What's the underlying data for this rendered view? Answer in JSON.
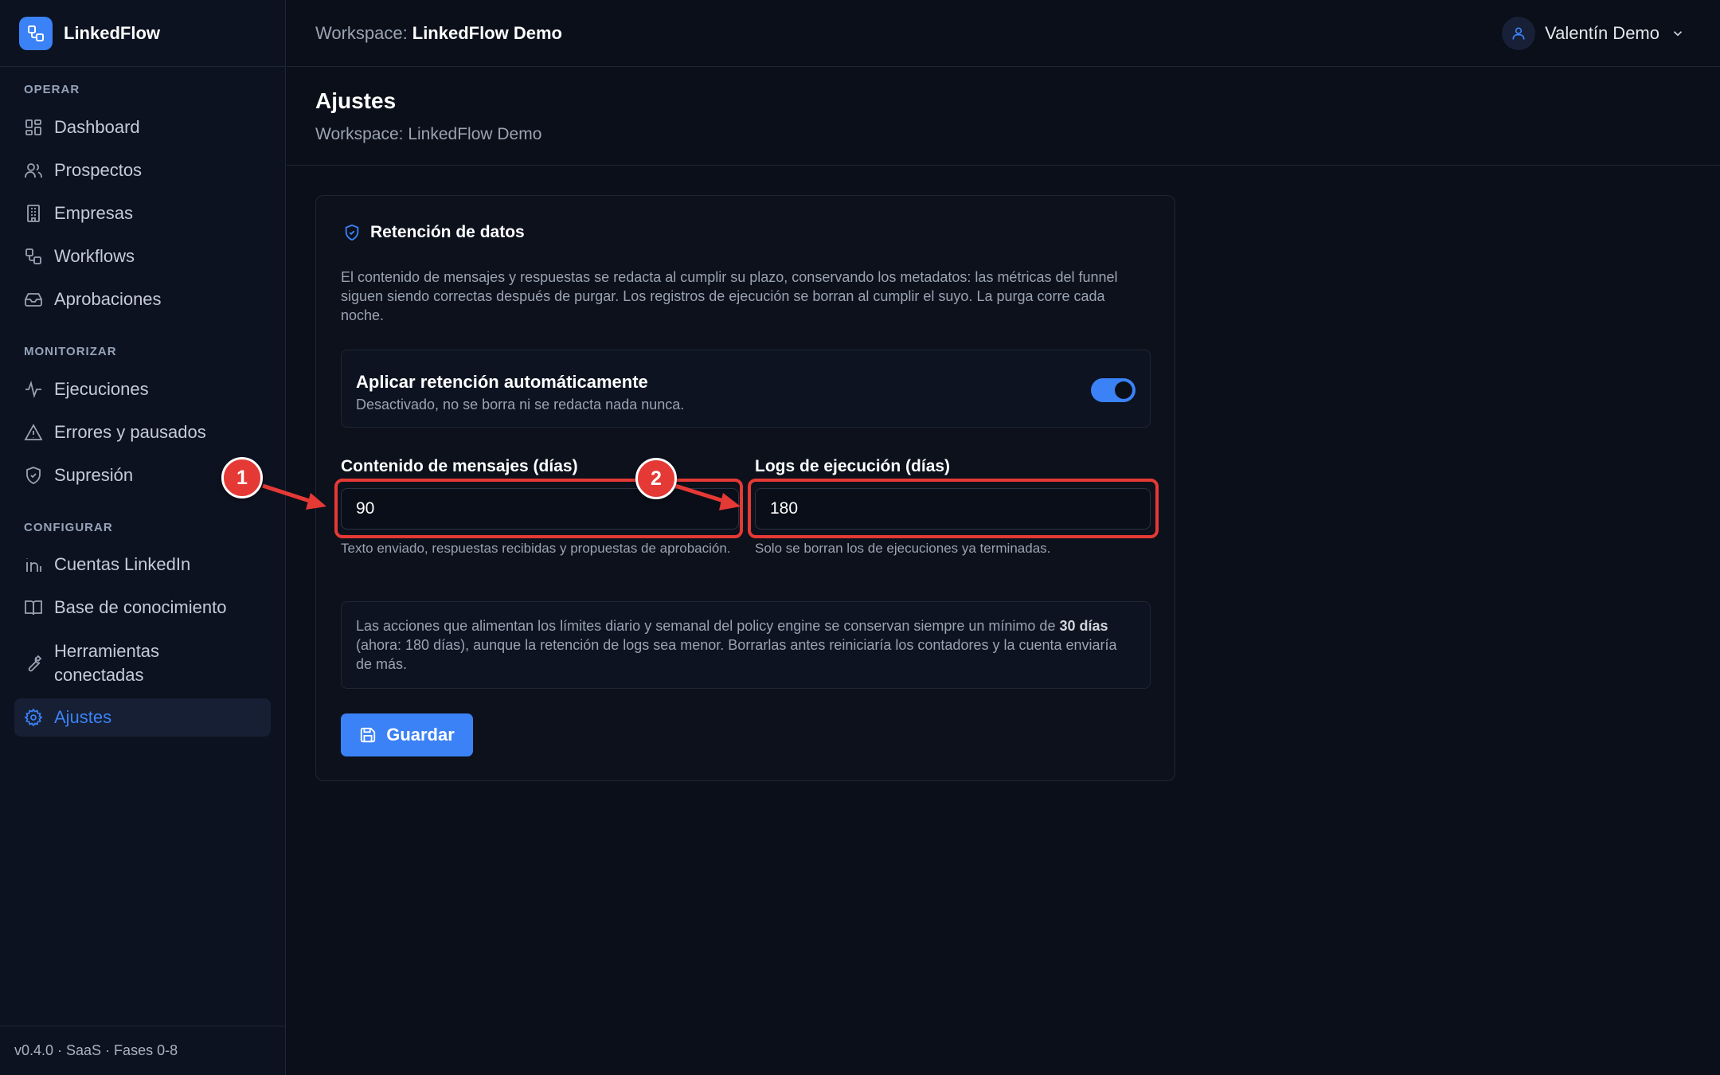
{
  "app": {
    "name": "LinkedFlow"
  },
  "sidebar": {
    "sections": {
      "operar": "OPERAR",
      "monitorizar": "MONITORIZAR",
      "configurar": "CONFIGURAR"
    },
    "items": [
      {
        "label": "Dashboard",
        "icon": "dashboard-icon"
      },
      {
        "label": "Prospectos",
        "icon": "users-icon"
      },
      {
        "label": "Empresas",
        "icon": "building-icon"
      },
      {
        "label": "Workflows",
        "icon": "workflow-icon"
      },
      {
        "label": "Aprobaciones",
        "icon": "inbox-icon"
      },
      {
        "label": "Ejecuciones",
        "icon": "activity-icon"
      },
      {
        "label": "Errores y pausados",
        "icon": "warning-icon"
      },
      {
        "label": "Supresión",
        "icon": "shield-icon"
      },
      {
        "label": "Cuentas LinkedIn",
        "icon": "linkedin-icon"
      },
      {
        "label": "Base de conocimiento",
        "icon": "book-icon"
      },
      {
        "label_line1": "Herramientas",
        "label_line2": "conectadas",
        "icon": "wrench-icon"
      },
      {
        "label": "Ajustes",
        "icon": "gear-icon",
        "active": true
      }
    ],
    "footer": "v0.4.0 · SaaS · Fases 0-8"
  },
  "topbar": {
    "workspace_prefix": "Workspace:",
    "workspace_name": "LinkedFlow Demo",
    "user_name": "Valentín Demo"
  },
  "page": {
    "title": "Ajustes",
    "subtitle": "Workspace: LinkedFlow Demo"
  },
  "retention": {
    "title": "Retención de datos",
    "description": "El contenido de mensajes y respuestas se redacta al cumplir su plazo, conservando los metadatos: las métricas del funnel siguen siendo correctas después de purgar. Los registros de ejecución se borran al cumplir el suyo. La purga corre cada noche.",
    "toggle_title": "Aplicar retención automáticamente",
    "toggle_sub": "Desactivado, no se borra ni se redacta nada nunca.",
    "toggle_on": true,
    "messages_label": "Contenido de mensajes (días)",
    "messages_value": "90",
    "messages_help": "Texto enviado, respuestas recibidas y propuestas de aprobación.",
    "logs_label": "Logs de ejecución (días)",
    "logs_value": "180",
    "logs_help": "Solo se borran los de ejecuciones ya terminadas.",
    "info_pre": "Las acciones que alimentan los límites diario y semanal del policy engine se conservan siempre un mínimo de ",
    "info_bold": "30 días",
    "info_post": " (ahora: 180 días), aunque la retención de logs sea menor. Borrarlas antes reiniciaría los contadores y la cuenta enviaría de más.",
    "save_label": "Guardar"
  },
  "annotations": {
    "badge1": "1",
    "badge2": "2",
    "color": "#e53935"
  },
  "colors": {
    "accent": "#3b82f6",
    "background": "#0b0f19",
    "sidebar": "#0d1220"
  }
}
